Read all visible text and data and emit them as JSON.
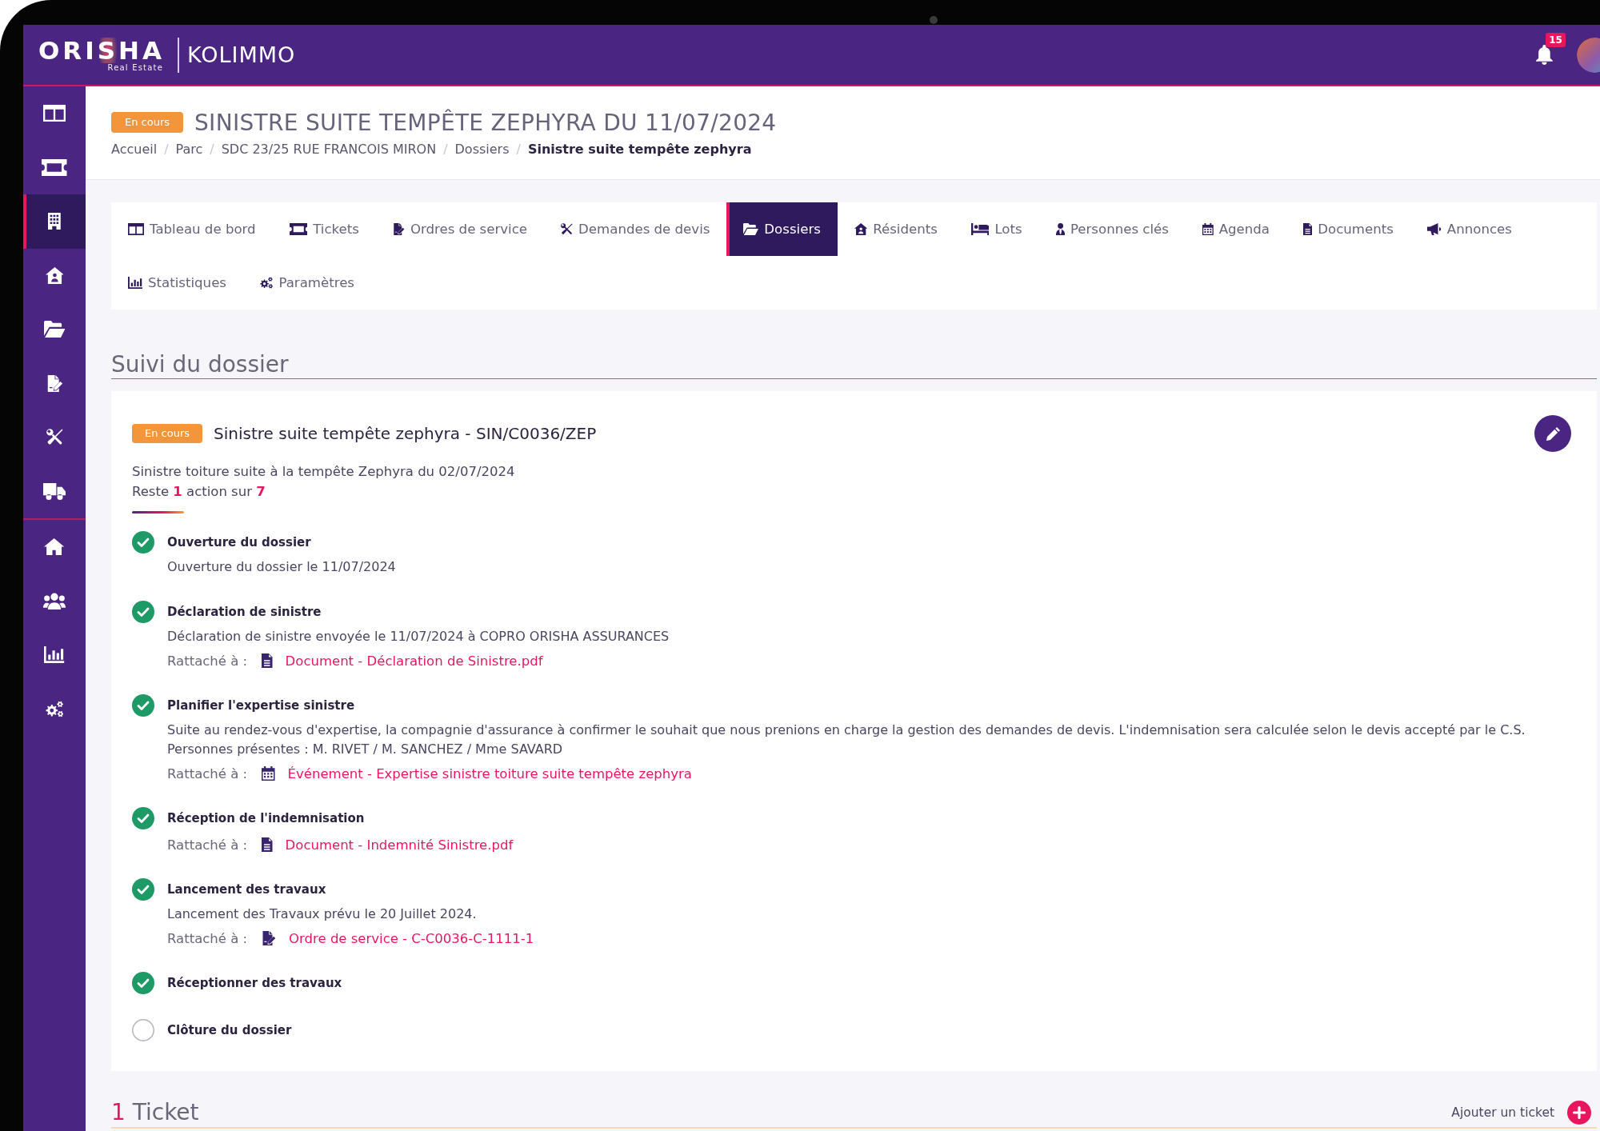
{
  "header": {
    "logo": {
      "brand": "ORISHA",
      "tagline": "Real Estate",
      "product": "KOLIMMO"
    },
    "notifications": {
      "count": "15"
    }
  },
  "sidebar": {
    "groups": [
      {
        "items": [
          {
            "selected": false
          },
          {
            "selected": false
          },
          {
            "selected": true
          },
          {
            "selected": false
          },
          {
            "selected": false
          },
          {
            "selected": false
          },
          {
            "selected": false
          },
          {
            "selected": false
          }
        ]
      },
      {
        "items": [
          {
            "selected": false
          },
          {
            "selected": false
          },
          {
            "selected": false
          },
          {
            "selected": false
          }
        ]
      }
    ]
  },
  "page_header": {
    "status": "En cours",
    "title": "SINISTRE SUITE TEMPÊTE ZEPHYRA DU 11/07/2024",
    "breadcrumb": [
      {
        "label": "Accueil",
        "current": false,
        "separator": "/"
      },
      {
        "label": "Parc",
        "current": false,
        "separator": "/"
      },
      {
        "label": "SDC 23/25 RUE FRANCOIS MIRON",
        "current": false,
        "separator": "/"
      },
      {
        "label": "Dossiers",
        "current": false,
        "separator": "/"
      },
      {
        "label": "Sinistre suite tempête zephyra",
        "current": true
      }
    ]
  },
  "tabs": [
    {
      "label": "Tableau de bord",
      "selected": false
    },
    {
      "label": "Tickets",
      "selected": false
    },
    {
      "label": "Ordres de service",
      "selected": false
    },
    {
      "label": "Demandes de devis",
      "selected": false
    },
    {
      "label": "Dossiers",
      "selected": true
    },
    {
      "label": "Résidents",
      "selected": false
    },
    {
      "label": "Lots",
      "selected": false
    },
    {
      "label": "Personnes clés",
      "selected": false
    },
    {
      "label": "Agenda",
      "selected": false
    },
    {
      "label": "Documents",
      "selected": false
    },
    {
      "label": "Annonces",
      "selected": false
    },
    {
      "label": "Statistiques",
      "selected": false
    },
    {
      "label": "Paramètres",
      "selected": false
    }
  ],
  "tracking": {
    "heading": "Suivi du dossier",
    "card": {
      "status": "En cours",
      "title": "Sinistre suite tempête zephyra - SIN/C0036/ZEP",
      "description": "Sinistre toiture suite à la tempête Zephyra du 02/07/2024",
      "progress": {
        "before": "Reste",
        "remaining": "1",
        "middle": "action sur",
        "total": "7"
      },
      "steps": [
        {
          "title": "Ouverture du dossier",
          "done": true,
          "details": [
            "Ouverture du dossier le 11/07/2024"
          ]
        },
        {
          "title": "Déclaration de sinistre",
          "done": true,
          "details": [
            "Déclaration de sinistre envoyée le 11/07/2024 à COPRO ORISHA ASSURANCES"
          ],
          "attachment": {
            "label": "Rattaché à :",
            "kind": "document",
            "link": "Document - Déclaration de Sinistre.pdf"
          }
        },
        {
          "title": "Planifier l'expertise sinistre",
          "done": true,
          "details": [
            "Suite au rendez-vous d'expertise, la compagnie d'assurance à confirmer le souhait que nous prenions en charge la gestion des demandes de devis. L'indemnisation sera calculée selon le devis accepté par le C.S. Personnes présentes : M. RIVET / M. SANCHEZ / Mme SAVARD"
          ],
          "attachment": {
            "label": "Rattaché à :",
            "kind": "event",
            "link": "Événement - Expertise sinistre toiture suite tempête zephyra"
          }
        },
        {
          "title": "Réception de l'indemnisation",
          "done": true,
          "attachment": {
            "label": "Rattaché à :",
            "kind": "document",
            "link": "Document - Indemnité Sinistre.pdf"
          }
        },
        {
          "title": "Lancement des travaux",
          "done": true,
          "details": [
            "Lancement des Travaux prévu le 20 Juillet 2024."
          ],
          "attachment": {
            "label": "Rattaché à :",
            "kind": "service_order",
            "link": "Ordre de service - C-C0036-C-1111-1"
          }
        },
        {
          "title": "Réceptionner des travaux",
          "done": true
        },
        {
          "title": "Clôture du dossier",
          "done": false
        }
      ]
    }
  },
  "tickets": {
    "count": "1",
    "label": "Ticket",
    "add_label": "Ajouter un ticket"
  }
}
